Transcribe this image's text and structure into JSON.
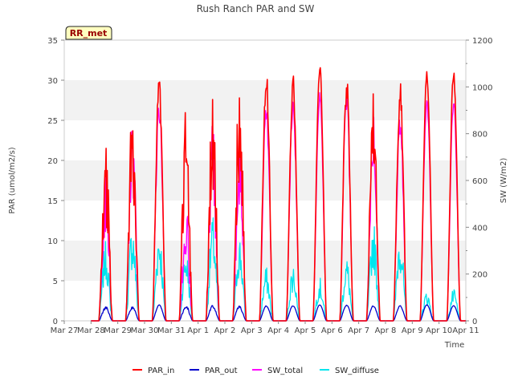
{
  "chart_data": {
    "type": "line",
    "title": "Rush Ranch PAR and SW",
    "badge": "RR_met",
    "xlabel": "Time",
    "ylabel_left": "PAR (umol/m2/s)",
    "ylabel_right": "SW (W/m2)",
    "x_range_days": [
      0,
      15
    ],
    "x_tick_labels": [
      "Mar 27",
      "Mar 28",
      "Mar 29",
      "Mar 30",
      "Mar 31",
      "Apr 1",
      "Apr 2",
      "Apr 3",
      "Apr 4",
      "Apr 5",
      "Apr 6",
      "Apr 7",
      "Apr 8",
      "Apr 9",
      "Apr 10",
      "Apr 11"
    ],
    "ylim_left": [
      0,
      35
    ],
    "ylim_right": [
      0,
      1200
    ],
    "y_ticks_left": [
      0,
      5,
      10,
      15,
      20,
      25,
      30,
      35
    ],
    "y_ticks_right": [
      0,
      200,
      400,
      600,
      800,
      1000,
      1200
    ],
    "grid": "horizontal bands",
    "legend_position": "bottom",
    "series": [
      {
        "name": "PAR_in",
        "color": "#ff0000",
        "axis": "left",
        "daily_peaks": [
          {
            "day": "Mar 28",
            "value": 24.0
          },
          {
            "day": "Mar 29",
            "value": 27.0
          },
          {
            "day": "Mar 30",
            "value": 31.5
          },
          {
            "day": "Mar 31",
            "value": 28.0
          },
          {
            "day": "Apr 1",
            "value": 30.0
          },
          {
            "day": "Apr 2",
            "value": 31.2
          },
          {
            "day": "Apr 3",
            "value": 31.7
          },
          {
            "day": "Apr 4",
            "value": 30.8
          },
          {
            "day": "Apr 5",
            "value": 32.4
          },
          {
            "day": "Apr 6",
            "value": 31.2
          },
          {
            "day": "Apr 7",
            "value": 28.9
          },
          {
            "day": "Apr 8",
            "value": 31.8
          },
          {
            "day": "Apr 9",
            "value": 31.4
          },
          {
            "day": "Apr 10",
            "value": 31.5
          }
        ]
      },
      {
        "name": "PAR_out",
        "color": "#0000cc",
        "axis": "left",
        "daily_peaks": [
          {
            "day": "Mar 28",
            "value": 1.8
          },
          {
            "day": "Mar 29",
            "value": 1.8
          },
          {
            "day": "Mar 30",
            "value": 2.0
          },
          {
            "day": "Mar 31",
            "value": 2.0
          },
          {
            "day": "Apr 1",
            "value": 2.0
          },
          {
            "day": "Apr 2",
            "value": 1.9
          },
          {
            "day": "Apr 3",
            "value": 1.9
          },
          {
            "day": "Apr 4",
            "value": 1.9
          },
          {
            "day": "Apr 5",
            "value": 2.0
          },
          {
            "day": "Apr 6",
            "value": 2.0
          },
          {
            "day": "Apr 7",
            "value": 1.9
          },
          {
            "day": "Apr 8",
            "value": 1.9
          },
          {
            "day": "Apr 9",
            "value": 2.0
          },
          {
            "day": "Apr 10",
            "value": 1.9
          }
        ]
      },
      {
        "name": "SW_total",
        "color": "#ff00ff",
        "axis": "right",
        "daily_peaks": [
          {
            "day": "Mar 28",
            "value": 720
          },
          {
            "day": "Mar 29",
            "value": 860
          },
          {
            "day": "Mar 30",
            "value": 970
          },
          {
            "day": "Mar 31",
            "value": 520
          },
          {
            "day": "Apr 1",
            "value": 850
          },
          {
            "day": "Apr 2",
            "value": 800
          },
          {
            "day": "Apr 3",
            "value": 960
          },
          {
            "day": "Apr 4",
            "value": 950
          },
          {
            "day": "Apr 5",
            "value": 980
          },
          {
            "day": "Apr 6",
            "value": 980
          },
          {
            "day": "Apr 7",
            "value": 920
          },
          {
            "day": "Apr 8",
            "value": 930
          },
          {
            "day": "Apr 9",
            "value": 950
          },
          {
            "day": "Apr 10",
            "value": 950
          }
        ]
      },
      {
        "name": "SW_diffuse",
        "color": "#00e5ee",
        "axis": "right",
        "daily_peaks": [
          {
            "day": "Mar 28",
            "value": 340
          },
          {
            "day": "Mar 29",
            "value": 430
          },
          {
            "day": "Mar 30",
            "value": 410
          },
          {
            "day": "Mar 31",
            "value": 310
          },
          {
            "day": "Apr 1",
            "value": 450
          },
          {
            "day": "Apr 2",
            "value": 370
          },
          {
            "day": "Apr 3",
            "value": 230
          },
          {
            "day": "Apr 4",
            "value": 245
          },
          {
            "day": "Apr 5",
            "value": 185
          },
          {
            "day": "Apr 6",
            "value": 275
          },
          {
            "day": "Apr 7",
            "value": 430
          },
          {
            "day": "Apr 8",
            "value": 410
          },
          {
            "day": "Apr 9",
            "value": 130
          },
          {
            "day": "Apr 10",
            "value": 135
          }
        ]
      }
    ]
  }
}
